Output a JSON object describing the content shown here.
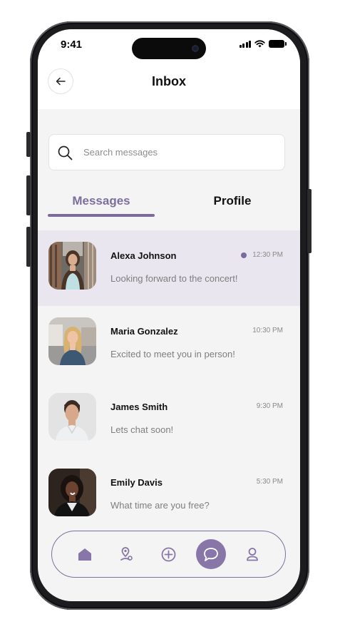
{
  "status_bar": {
    "time": "9:41"
  },
  "header": {
    "title": "Inbox"
  },
  "search": {
    "placeholder": "Search messages"
  },
  "tabs": [
    {
      "label": "Messages",
      "active": true
    },
    {
      "label": "Profile",
      "active": false
    }
  ],
  "messages": [
    {
      "name": "Alexa Johnson",
      "text": "Looking forward to the concert!",
      "time": "12:30 PM",
      "unread": true
    },
    {
      "name": "Maria Gonzalez",
      "text": "Excited to meet you in person!",
      "time": "10:30 PM",
      "unread": false
    },
    {
      "name": "James Smith",
      "text": "Lets chat soon!",
      "time": "9:30 PM",
      "unread": false
    },
    {
      "name": "Emily Davis",
      "text": "What time are you free?",
      "time": "5:30 PM",
      "unread": false
    }
  ],
  "bottom_nav": [
    {
      "icon": "home-icon"
    },
    {
      "icon": "map-pin-icon"
    },
    {
      "icon": "add-circle-icon"
    },
    {
      "icon": "chat-bubble-icon",
      "active": true
    },
    {
      "icon": "user-icon"
    }
  ],
  "colors": {
    "accent": "#7b6a9b",
    "active_row": "#e9e6ef",
    "background": "#f4f4f4"
  }
}
